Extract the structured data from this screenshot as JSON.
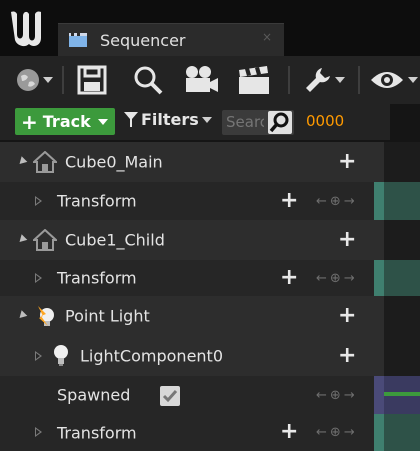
{
  "window": {
    "tab_title": "Sequencer",
    "tab_close": "×"
  },
  "toolbar": {
    "buttons": [
      {
        "icon": "world-settings-icon",
        "has_dropdown": true
      },
      {
        "icon": "save-icon"
      },
      {
        "icon": "search-icon"
      },
      {
        "icon": "camera-icon"
      },
      {
        "icon": "clapperboard-icon"
      },
      {
        "icon": "wrench-icon",
        "has_dropdown": true
      },
      {
        "icon": "eye-icon",
        "has_dropdown": true
      }
    ]
  },
  "filterbar": {
    "track_label": "Track",
    "filters_label": "Filters",
    "search_placeholder": "Search",
    "frame_value": "0000"
  },
  "tree": {
    "rows": [
      {
        "label": "Cube0_Main",
        "type": "actor",
        "icon": "actor-icon"
      },
      {
        "label": "Transform",
        "type": "track"
      },
      {
        "label": "Cube1_Child",
        "type": "actor",
        "icon": "actor-icon"
      },
      {
        "label": "Transform",
        "type": "track"
      },
      {
        "label": "Point Light",
        "type": "actor",
        "icon": "point-light-icon"
      },
      {
        "label": "LightComponent0",
        "type": "component",
        "icon": "bulb-icon"
      },
      {
        "label": "Spawned",
        "type": "property",
        "checked": true
      },
      {
        "label": "Transform",
        "type": "track"
      }
    ]
  },
  "colors": {
    "accent_green": "#3c9a3c",
    "frame_orange": "#ff9a00",
    "track_teal": "#3f7f6f",
    "spawn_purple": "#4a4a78"
  }
}
